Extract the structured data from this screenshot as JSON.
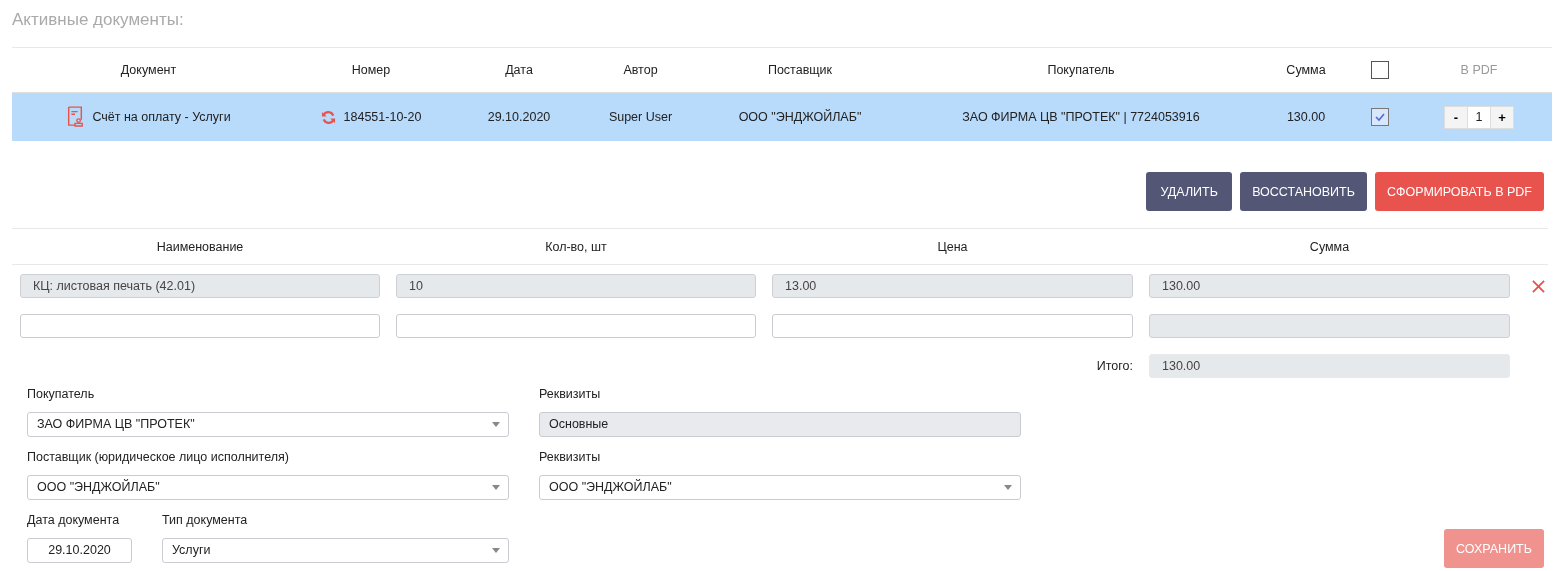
{
  "title": "Активные документы:",
  "documents": {
    "columns": [
      "Документ",
      "Номер",
      "Дата",
      "Автор",
      "Поставщик",
      "Покупатель",
      "Сумма"
    ],
    "select_all": {
      "checked": false
    },
    "pdf_column": "В PDF",
    "rows": [
      {
        "document": "Счёт на оплату - Услуги",
        "number": "184551-10-20",
        "date": "29.10.2020",
        "author": "Super User",
        "supplier": "ООО \"ЭНДЖОЙЛАБ\"",
        "buyer": "ЗАО ФИРМА ЦВ \"ПРОТЕК\" | 7724053916",
        "sum": "130.00",
        "selected": true,
        "checked": true,
        "copies": {
          "minus": "-",
          "value": "1",
          "plus": "+"
        }
      }
    ]
  },
  "actions": [
    {
      "label": "УДАЛИТЬ",
      "kind": "secondary"
    },
    {
      "label": "ВОССТАНОВИТЬ",
      "kind": "secondary"
    },
    {
      "label": "СФОРМИРОВАТЬ В PDF",
      "kind": "primary"
    }
  ],
  "items": {
    "columns": [
      "Наименование",
      "Кол-во, шт",
      "Цена",
      "Сумма"
    ],
    "rows": [
      {
        "removable": true,
        "fields": [
          {
            "value": "КЦ: листовая печать (42.01)",
            "disabled": true
          },
          {
            "value": "10",
            "disabled": true
          },
          {
            "value": "13.00",
            "disabled": true
          },
          {
            "value": "130.00",
            "disabled": true
          }
        ]
      },
      {
        "removable": false,
        "fields": [
          {
            "disabled": false
          },
          {
            "disabled": false
          },
          {
            "disabled": false
          },
          {
            "disabled": true
          }
        ]
      }
    ],
    "total": {
      "label": "Итого:",
      "value": "130.00"
    }
  },
  "form": {
    "buyer": {
      "label": "Покупатель",
      "value": "ЗАО ФИРМА ЦВ \"ПРОТЕК\""
    },
    "buyer_details": {
      "label": "Реквизиты",
      "value": "Основные",
      "disabled": true
    },
    "supplier": {
      "label": "Поставщик (юридическое лицо исполнителя)",
      "value": "ООО \"ЭНДЖОЙЛАБ\""
    },
    "supplier_details": {
      "label": "Реквизиты",
      "value": "ООО \"ЭНДЖОЙЛАБ\""
    },
    "date": {
      "label": "Дата документа",
      "value": "29.10.2020"
    },
    "doc_type": {
      "label": "Тип документа",
      "value": "Услуги"
    }
  },
  "save": {
    "label": "СОХРАНИТЬ",
    "disabled": true
  }
}
